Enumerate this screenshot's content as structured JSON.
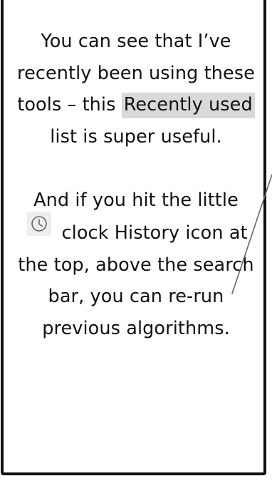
{
  "callout": {
    "paragraph_1": {
      "before": "You can see that I’ve recently been using these tools – this ",
      "highlight": "Recently used",
      "after": " list is super useful."
    },
    "paragraph_2": {
      "before": "And if you hit the little ",
      "icon": "clock-icon",
      "after": " clock History icon at the top, above the search bar, you can re-run previous algorithms."
    },
    "highlight_color": "#d9d9d9",
    "border_color": "#111111",
    "pointer_color": "#666666"
  }
}
